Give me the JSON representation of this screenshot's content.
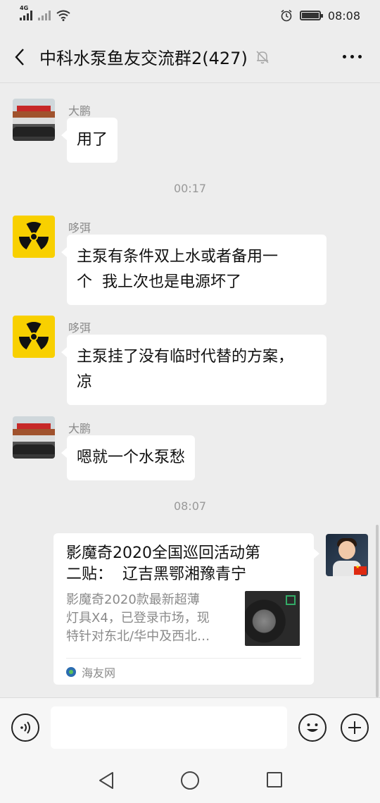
{
  "status_bar": {
    "network_label": "4G",
    "time": "08:08"
  },
  "header": {
    "title": "中科水泵鱼友交流群2(427)",
    "icons": {
      "back": "chevron-left-icon",
      "mute": "bell-muted-icon",
      "more": "more-dots-icon"
    }
  },
  "messages": [
    {
      "sender": "大鹏",
      "text": "用了",
      "avatar": "building-photo"
    },
    {
      "timestamp": "00:17"
    },
    {
      "sender": "哆弭",
      "text_lines": [
        "主泵有条件双上水或者备用一",
        "个  我上次也是电源坏了"
      ],
      "avatar": "radioactive-symbol"
    },
    {
      "sender": "哆弭",
      "text_lines": [
        "主泵挂了没有临时代替的方案，",
        "凉"
      ],
      "avatar": "radioactive-symbol"
    },
    {
      "sender": "大鹏",
      "text": "嗯就一个水泵愁",
      "avatar": "building-photo"
    },
    {
      "timestamp": "08:07"
    }
  ],
  "link_card": {
    "title_lines": [
      "影魔奇2020全国巡回活动第",
      "二贴：  辽吉黑鄂湘豫青宁"
    ],
    "desc_lines": [
      "影魔奇2020款最新超薄",
      "灯具X4，已登录市场，现",
      "特针对东北/华中及西北…"
    ],
    "source": "海友网"
  },
  "input_bar": {
    "icons": {
      "voice": "voice-icon",
      "emoji": "emoji-icon",
      "plus": "plus-icon"
    }
  },
  "colors": {
    "background": "#ededed",
    "bubble": "#ffffff",
    "radioactive_yellow": "#f8d000"
  }
}
